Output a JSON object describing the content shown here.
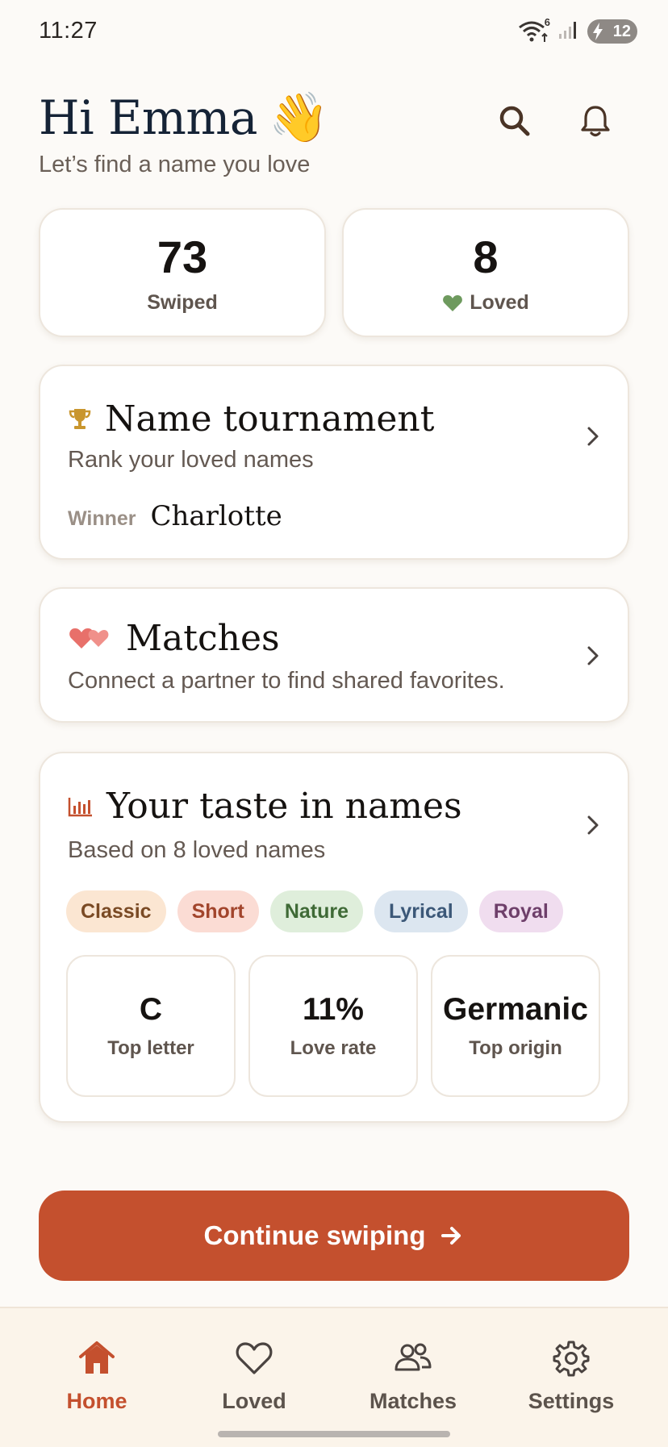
{
  "status_bar": {
    "time": "11:27",
    "wifi_badge": "6",
    "battery": "12"
  },
  "header": {
    "greeting": "Hi Emma",
    "wave_emoji": "👋",
    "subtitle": "Let’s find a name you love",
    "icons": [
      "search-icon",
      "bell-icon"
    ]
  },
  "stats": {
    "swiped": {
      "value": "73",
      "label": "Swiped"
    },
    "loved": {
      "value": "8",
      "label": "Loved"
    }
  },
  "tournament": {
    "title": "Name tournament",
    "subtitle": "Rank your loved names",
    "winner_label": "Winner",
    "winner_name": "Charlotte"
  },
  "matches": {
    "title": "Matches",
    "subtitle": "Connect a partner to find shared favorites."
  },
  "taste": {
    "title": "Your taste in names",
    "subtitle": "Based on 8 loved names",
    "tags": [
      {
        "label": "Classic",
        "bg": "#FBE6D2",
        "fg": "#7A4A24"
      },
      {
        "label": "Short",
        "bg": "#FBDCD4",
        "fg": "#A2452C"
      },
      {
        "label": "Nature",
        "bg": "#DFEEDB",
        "fg": "#3F6A36"
      },
      {
        "label": "Lyrical",
        "bg": "#DCE6F0",
        "fg": "#3C5878"
      },
      {
        "label": "Royal",
        "bg": "#F0DDEF",
        "fg": "#6E3F6A"
      }
    ],
    "stats": [
      {
        "value": "C",
        "label": "Top letter"
      },
      {
        "value": "11%",
        "label": "Love rate"
      },
      {
        "value": "Germanic",
        "label": "Top origin"
      }
    ]
  },
  "cta": {
    "label": "Continue swiping"
  },
  "nav": {
    "items": [
      {
        "label": "Home",
        "icon": "home-icon",
        "active": true
      },
      {
        "label": "Loved",
        "icon": "heart-icon",
        "active": false
      },
      {
        "label": "Matches",
        "icon": "people-icon",
        "active": false
      },
      {
        "label": "Settings",
        "icon": "gear-icon",
        "active": false
      }
    ]
  },
  "colors": {
    "accent": "#C4502E",
    "background": "#FCFAF7",
    "title_navy": "#152336",
    "loved_heart": "#6E9A5E",
    "trophy": "#C9962E",
    "matches_hearts": "#E8706A",
    "chart_icon": "#C4502E"
  }
}
